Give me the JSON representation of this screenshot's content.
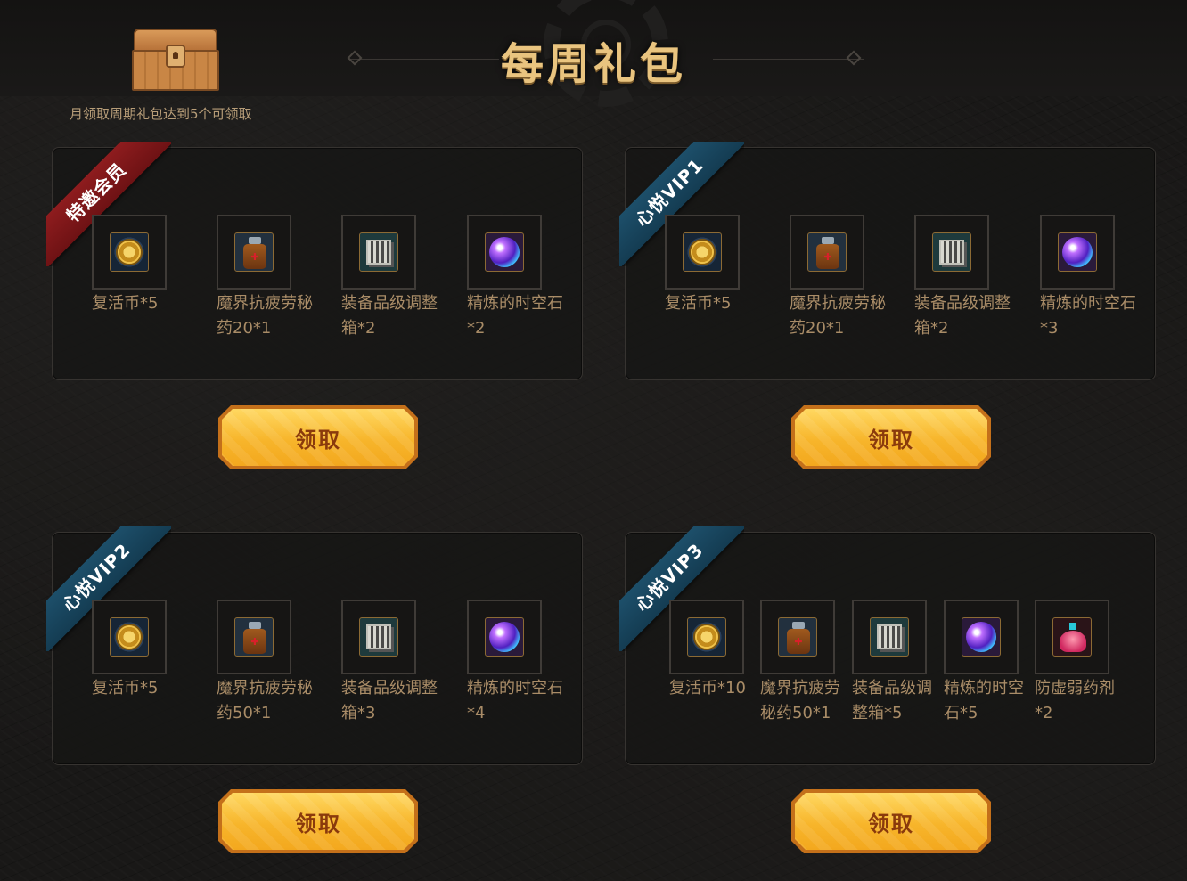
{
  "header": {
    "title": "每周礼包",
    "chest_note": "月领取周期礼包达到5个可领取"
  },
  "panels": [
    {
      "tier": "特邀会员",
      "ribbon_color": "#8e1c1e",
      "claim_label": "领取",
      "items": [
        {
          "icon": "coin-icon",
          "label": "复活币*5"
        },
        {
          "icon": "potion-icon",
          "label": "魔界抗疲劳秘药20*1"
        },
        {
          "icon": "box-icon",
          "label": "装备品级调整箱*2"
        },
        {
          "icon": "orb-icon",
          "label": "精炼的时空石*2"
        }
      ]
    },
    {
      "tier": "心悦VIP1",
      "ribbon_color": "#1d4f6a",
      "claim_label": "领取",
      "items": [
        {
          "icon": "coin-icon",
          "label": "复活币*5"
        },
        {
          "icon": "potion-icon",
          "label": "魔界抗疲劳秘药20*1"
        },
        {
          "icon": "box-icon",
          "label": "装备品级调整箱*2"
        },
        {
          "icon": "orb-icon",
          "label": "精炼的时空石*3"
        }
      ]
    },
    {
      "tier": "心悦VIP2",
      "ribbon_color": "#1d4f6a",
      "claim_label": "领取",
      "items": [
        {
          "icon": "coin-icon",
          "label": "复活币*5"
        },
        {
          "icon": "potion-icon",
          "label": "魔界抗疲劳秘药50*1"
        },
        {
          "icon": "box-icon",
          "label": "装备品级调整箱*3"
        },
        {
          "icon": "orb-icon",
          "label": "精炼的时空石*4"
        }
      ]
    },
    {
      "tier": "心悦VIP3",
      "ribbon_color": "#1d4f6a",
      "claim_label": "领取",
      "items": [
        {
          "icon": "coin-icon",
          "label": "复活币*10"
        },
        {
          "icon": "potion-icon",
          "label": "魔界抗疲劳秘药50*1"
        },
        {
          "icon": "box-icon",
          "label": "装备品级调整箱*5"
        },
        {
          "icon": "orb-icon",
          "label": "精炼的时空石*5"
        },
        {
          "icon": "flask-icon",
          "label": "防虚弱药剂*2"
        }
      ]
    }
  ]
}
